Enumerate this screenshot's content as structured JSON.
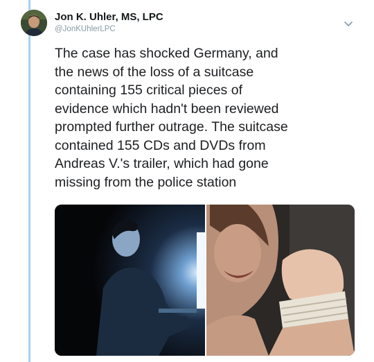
{
  "tweet": {
    "author_name": "Jon K. Uhler, MS, LPC",
    "author_handle": "@JonKUhlerLPC",
    "text": "The case has shocked Germany, and\nthe news of the loss of a suitcase\ncontaining 155 critical pieces of\nevidence which hadn't been reviewed\nprompted further outrage. The suitcase\ncontained 155 CDs and DVDs from\nAndreas V.'s trailer, which had gone\nmissing from the police station"
  },
  "icons": {
    "menu": "chevron-down-icon"
  },
  "colors": {
    "thread_line": "#a3d3f5",
    "handle_gray": "#8a9aa6"
  }
}
